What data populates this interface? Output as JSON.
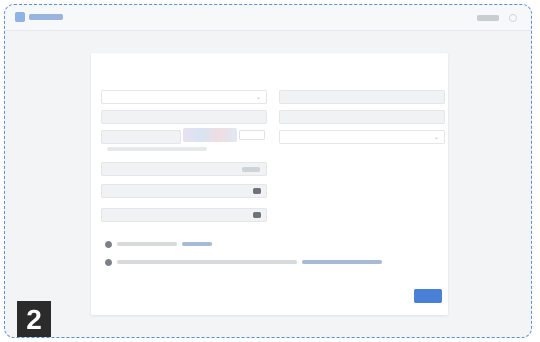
{
  "badge": {
    "number": "2"
  },
  "captcha": {
    "chars": [
      "",
      "",
      "",
      ""
    ]
  },
  "colors": {
    "accent": "#4a7fd6",
    "frame_border": "#5b8fd6",
    "badge_bg": "#2b2b2b"
  },
  "icons": {
    "select_caret": "chevron-down-icon",
    "password_toggle": "eye-icon",
    "checkbox": "checkbox-icon"
  }
}
